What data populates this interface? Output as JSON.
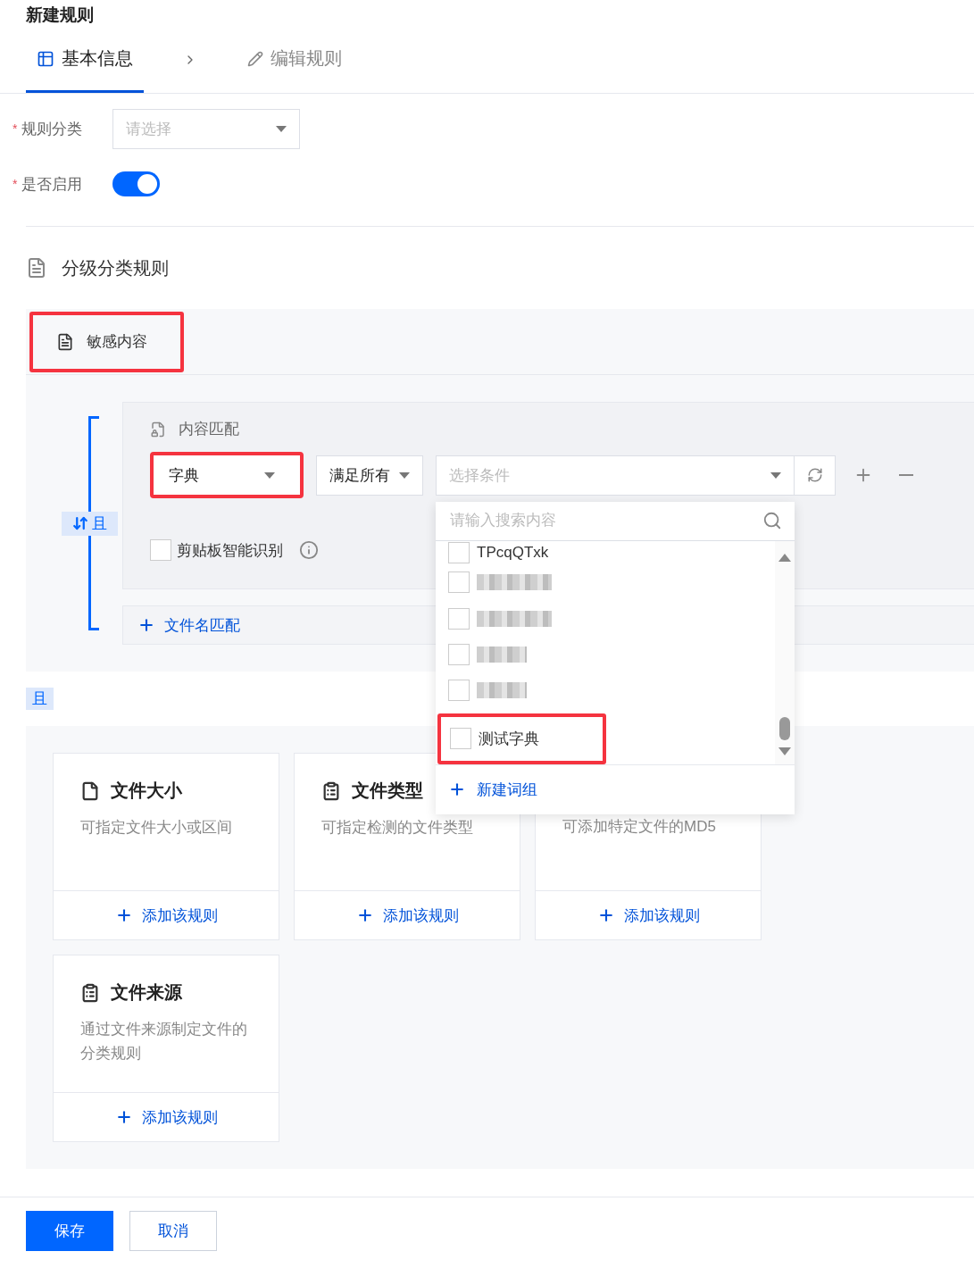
{
  "page_title": "新建规则",
  "steps": [
    {
      "label": "基本信息",
      "selected": true
    },
    {
      "label": "编辑规则",
      "selected": false
    }
  ],
  "form": {
    "category": {
      "label": "规则分类",
      "required_mark": "*",
      "placeholder": "请选择"
    },
    "enabled": {
      "label": "是否启用",
      "required_mark": "*",
      "on": true
    }
  },
  "section_title": "分级分类规则",
  "sensitive_tab": {
    "label": "敏感内容",
    "highlighted": true
  },
  "logic_badge": "且",
  "content_match": {
    "title": "内容匹配",
    "type_select": {
      "value": "字典",
      "highlighted": true
    },
    "mode_select": {
      "value": "满足所有"
    },
    "condition_select": {
      "placeholder": "选择条件"
    },
    "clipboard": {
      "label": "剪贴板智能识别",
      "checked": false
    }
  },
  "filename_match": "文件名匹配",
  "and_badge": "且",
  "dropdown": {
    "search_placeholder": "请输入搜索内容",
    "options": [
      {
        "kind": "text",
        "label": "TPcqQTxk",
        "checked": false,
        "highlighted": false
      },
      {
        "kind": "redacted",
        "checked": false,
        "highlighted": false
      },
      {
        "kind": "redacted",
        "checked": false,
        "highlighted": false
      },
      {
        "kind": "redacted",
        "checked": false,
        "highlighted": false
      },
      {
        "kind": "redacted",
        "checked": false,
        "highlighted": false
      },
      {
        "kind": "text",
        "label": "测试字典",
        "checked": false,
        "highlighted": true
      }
    ],
    "create_label": "新建词组"
  },
  "rule_cards": [
    {
      "kind": "file",
      "title": "文件大小",
      "description": "可指定文件大小或区间",
      "action": "添加该规则"
    },
    {
      "kind": "clipboard",
      "title": "文件类型",
      "description": "可指定检测的文件类型",
      "action": "添加该规则"
    },
    {
      "description": "可添加特定文件的MD5",
      "action": "添加该规则"
    },
    {
      "kind": "clipboard",
      "title": "文件来源",
      "description": "通过文件来源制定文件的分类规则",
      "action": "添加该规则"
    }
  ],
  "buttons": {
    "save": "保存",
    "cancel": "取消"
  }
}
